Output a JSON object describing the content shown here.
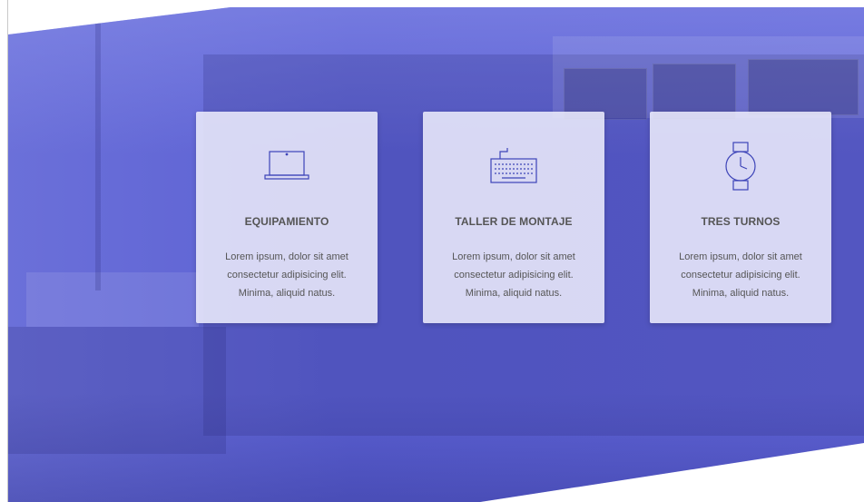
{
  "features": [
    {
      "icon": "laptop-icon",
      "title": "EQUIPAMIENTO",
      "text_lines": [
        "Lorem ipsum, dolor sit amet",
        "consectetur adipisicing elit.",
        "Minima, aliquid natus."
      ]
    },
    {
      "icon": "keyboard-icon",
      "title": "TALLER DE MONTAJE",
      "text_lines": [
        "Lorem ipsum, dolor sit amet",
        "consectetur adipisicing elit.",
        "Minima, aliquid natus."
      ]
    },
    {
      "icon": "watch-icon",
      "title": "TRES TURNOS",
      "text_lines": [
        "Lorem ipsum, dolor sit amet",
        "consectetur adipisicing elit.",
        "Minima, aliquid natus."
      ]
    }
  ],
  "colors": {
    "overlay": "#5b60d3",
    "icon_stroke": "#3d44b8",
    "card_text": "#555555"
  }
}
